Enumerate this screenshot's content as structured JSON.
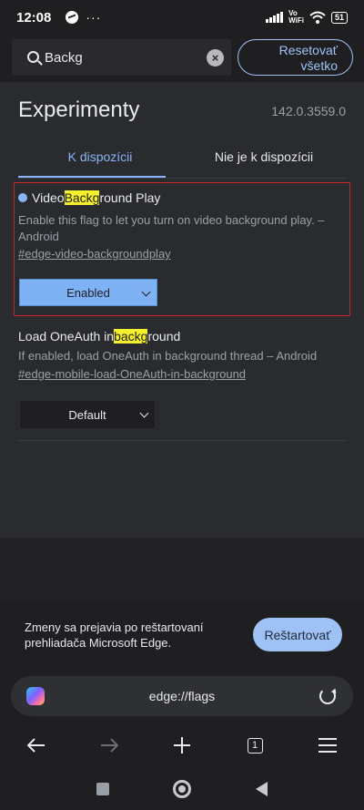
{
  "status_bar": {
    "time": "12:08",
    "dots": "···",
    "vo_wifi_top": "Vo",
    "vo_wifi_bottom": "WiFi",
    "battery": "51"
  },
  "search": {
    "value": "Backg",
    "reset_label_line1": "Resetovať",
    "reset_label_line2": "všetko"
  },
  "page": {
    "title": "Experimenty",
    "version": "142.0.3559.0"
  },
  "tabs": {
    "available": "K dispozícii",
    "unavailable": "Nie je k dispozícii"
  },
  "flags": [
    {
      "title_before": "Video ",
      "title_highlight": "Backg",
      "title_after": "round Play",
      "description": "Enable this flag to let you turn on video background play. – Android",
      "link": "#edge-video-backgroundplay",
      "selected": "Enabled",
      "modified": true
    },
    {
      "title_before": "Load OneAuth in ",
      "title_highlight": "backg",
      "title_after": "round",
      "description": "If enabled, load OneAuth in background thread – Android",
      "link": "#edge-mobile-load-OneAuth-in-background",
      "selected": "Default",
      "modified": false
    }
  ],
  "restart": {
    "message": "Zmeny sa prejavia po reštartovaní prehliadača Microsoft Edge.",
    "button": "Reštartovať"
  },
  "address_bar": {
    "url": "edge://flags"
  },
  "toolbar": {
    "tab_count": "1"
  },
  "colors": {
    "accent": "#8ab4f8",
    "highlight": "#f5f02b",
    "modified_border": "#c62828",
    "background": "#2a2b2f"
  },
  "icons": [
    "messenger-icon",
    "search-icon",
    "clear-icon",
    "copilot-icon",
    "reload-icon",
    "back-arrow-icon",
    "forward-arrow-icon",
    "new-tab-plus-icon",
    "tab-switcher-icon",
    "menu-icon"
  ]
}
